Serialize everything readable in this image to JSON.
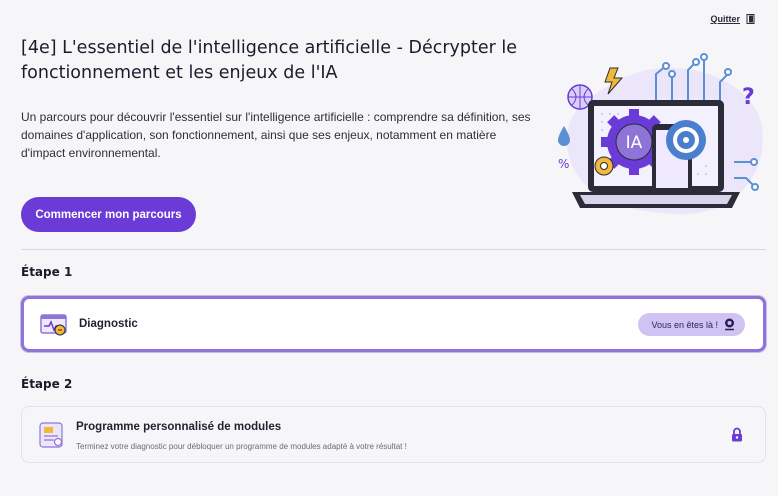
{
  "header": {
    "quit_label": "Quitter",
    "title": "[4e] L'essentiel de l'intelligence artificielle - Décrypter le fonctionnement et les enjeux de l'IA",
    "description": "Un parcours pour découvrir l'essentiel sur l'intelligence artificielle : comprendre sa définition, ses domaines d'application, son fonctionnement, ainsi que ses enjeux, notamment en matière d'impact environnemental.",
    "start_button": "Commencer mon parcours",
    "illustration_text": "IA"
  },
  "steps": [
    {
      "label": "Étape 1",
      "card": {
        "title": "Diagnostic",
        "badge": "Vous en êtes là !",
        "icon": "diagnostic-icon",
        "status": "current"
      }
    },
    {
      "label": "Étape 2",
      "card": {
        "title": "Programme personnalisé de modules",
        "subtitle": "Terminez votre diagnostic pour débloquer un programme de modules adapté à votre résultat !",
        "icon": "modules-program-icon",
        "status": "locked"
      }
    }
  ],
  "colors": {
    "accent": "#6a3bd6",
    "active_border": "#8f74d8",
    "badge_bg": "#cfc3f3",
    "lock": "#6a3bd6",
    "background": "#f6f6f8"
  }
}
